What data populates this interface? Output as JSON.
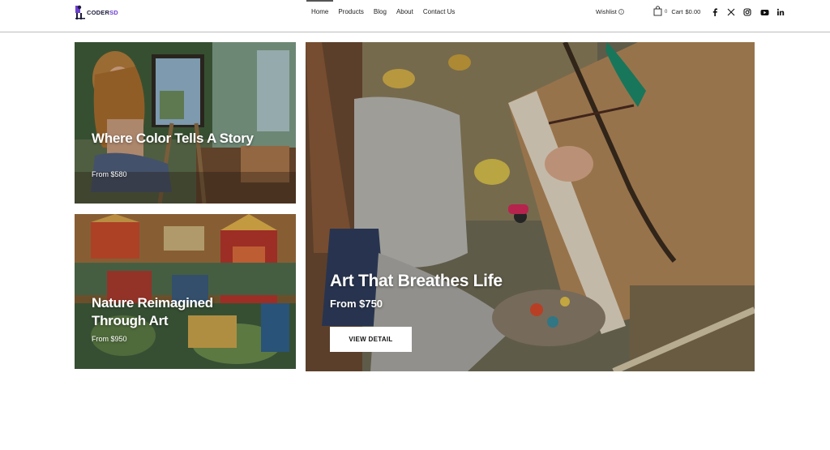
{
  "brand": {
    "logo_part1": "CODER",
    "logo_part2": "SD"
  },
  "nav": {
    "items": [
      {
        "label": "Home",
        "active": true
      },
      {
        "label": "Products",
        "active": false
      },
      {
        "label": "Blog",
        "active": false
      },
      {
        "label": "About",
        "active": false
      },
      {
        "label": "Contact Us",
        "active": false
      }
    ]
  },
  "header": {
    "wishlist_label": "Wishlist",
    "cart_count": "0",
    "cart_label": "Cart",
    "cart_total": "$0.00",
    "social_icons": [
      "facebook-icon",
      "x-twitter-icon",
      "instagram-icon",
      "youtube-icon",
      "linkedin-icon"
    ]
  },
  "cards": [
    {
      "title": "Where Color Tells A Story",
      "price": "From $580"
    },
    {
      "title": "Nature Reimagined Through Art",
      "price": "From $950"
    },
    {
      "title": "Art That Breathes Life",
      "price": "From $750",
      "button_label": "VIEW DETAIL"
    }
  ],
  "colors": {
    "brand_dark": "#1b1b3a",
    "brand_accent": "#6d3fd0",
    "header_border": "#bdbdbd"
  }
}
